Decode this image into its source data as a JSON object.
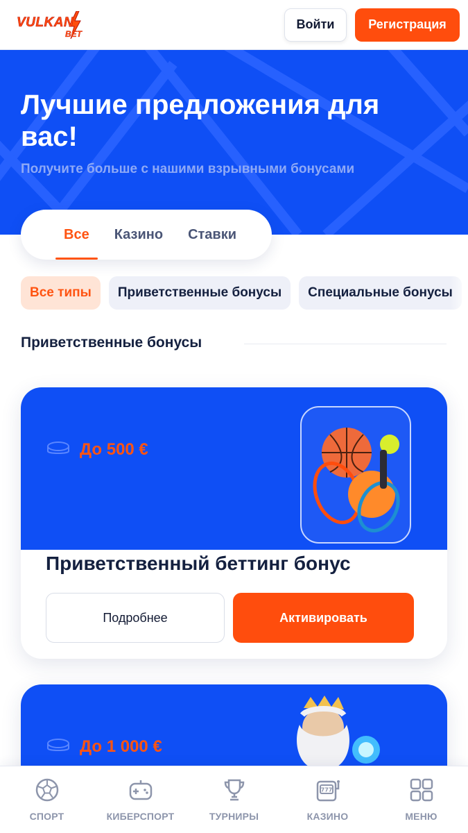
{
  "header": {
    "logo_main": "VULKAN",
    "logo_sub": "BET",
    "login_label": "Войти",
    "register_label": "Регистрация"
  },
  "hero": {
    "title": "Лучшие предложения для вас!",
    "subtitle": "Получите больше с нашими взрывными бонусами"
  },
  "tabs": [
    {
      "label": "Все",
      "active": true
    },
    {
      "label": "Казино",
      "active": false
    },
    {
      "label": "Ставки",
      "active": false
    }
  ],
  "filters": [
    {
      "label": "Все типы",
      "active": true
    },
    {
      "label": "Приветственные бонусы",
      "active": false
    },
    {
      "label": "Специальные бонусы",
      "active": false
    }
  ],
  "section": {
    "title": "Приветственные бонусы"
  },
  "cards": [
    {
      "amount": "До 500 €",
      "title": "Приветственный беттинг бонус",
      "more_label": "Подробнее",
      "activate_label": "Активировать",
      "illustration": "sports-balls-glass-cube"
    },
    {
      "amount": "До 1 000 €",
      "illustration": "zeus-with-lightning-orb"
    }
  ],
  "bottom_nav": [
    {
      "label": "СПОРТ",
      "icon": "soccer-ball-icon"
    },
    {
      "label": "КИБЕРСПОРТ",
      "icon": "gamepad-icon"
    },
    {
      "label": "ТУРНИРЫ",
      "icon": "trophy-icon"
    },
    {
      "label": "КАЗИНО",
      "icon": "slot-machine-icon"
    },
    {
      "label": "МЕНЮ",
      "icon": "grid-menu-icon"
    }
  ],
  "colors": {
    "brand_blue": "#0f4ff5",
    "accent_orange": "#ff4d0d",
    "text_dark": "#14203f",
    "nav_gray": "#8d95ab"
  }
}
